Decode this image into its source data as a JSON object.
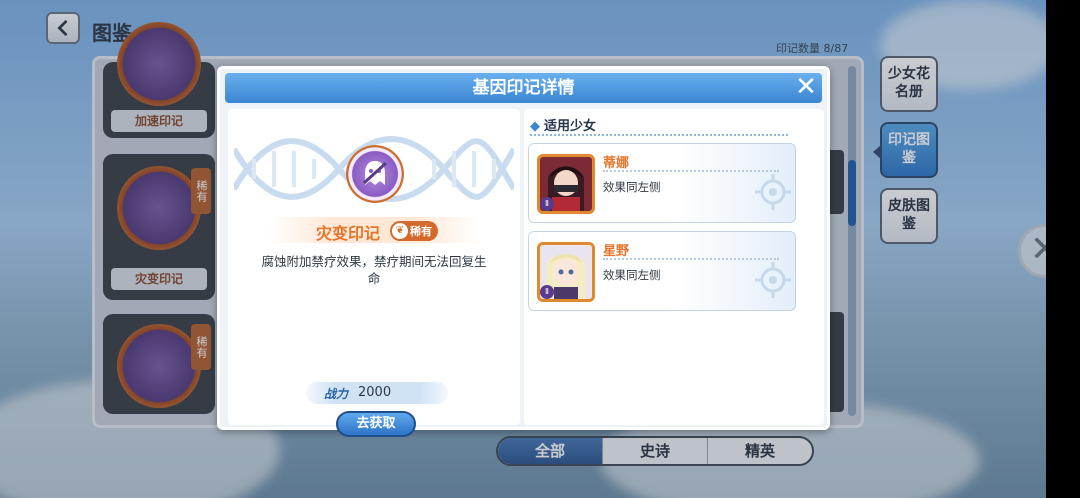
{
  "header": {
    "title": "图鉴",
    "mark_count_label": "印记数量 8/87"
  },
  "background_cards": [
    {
      "name": "加速印记",
      "rare": ""
    },
    {
      "name": "灾变印记",
      "rare": "稀有"
    },
    {
      "name": "",
      "rare": "稀有"
    }
  ],
  "side_tabs": [
    {
      "label": "少女花名册",
      "active": false
    },
    {
      "label": "印记图鉴",
      "active": true
    },
    {
      "label": "皮肤图鉴",
      "active": false
    }
  ],
  "filter_tabs": [
    {
      "label": "全部",
      "active": true
    },
    {
      "label": "史诗",
      "active": false
    },
    {
      "label": "精英",
      "active": false
    }
  ],
  "modal": {
    "title": "基因印记详情",
    "close": "✕",
    "mark": {
      "name": "灾变印记",
      "rarity": "稀有",
      "description": "腐蚀附加禁疗效果，禁疗期间无法回复生命",
      "power_label": "战力",
      "power_value": "2000",
      "get_button": "去获取"
    },
    "applicable": {
      "title": "适用少女",
      "girls": [
        {
          "name": "蒂娜",
          "effect": "效果同左侧"
        },
        {
          "name": "星野",
          "effect": "效果同左侧"
        }
      ]
    }
  },
  "colors": {
    "accent_blue": "#3a85d2",
    "rare_orange": "#d36a2c",
    "name_orange": "#e3752c"
  },
  "icons": [
    "back-arrow-icon",
    "close-icon",
    "dna-helix-icon",
    "ghost-emblem-icon",
    "leaf-icon",
    "power-icon"
  ]
}
